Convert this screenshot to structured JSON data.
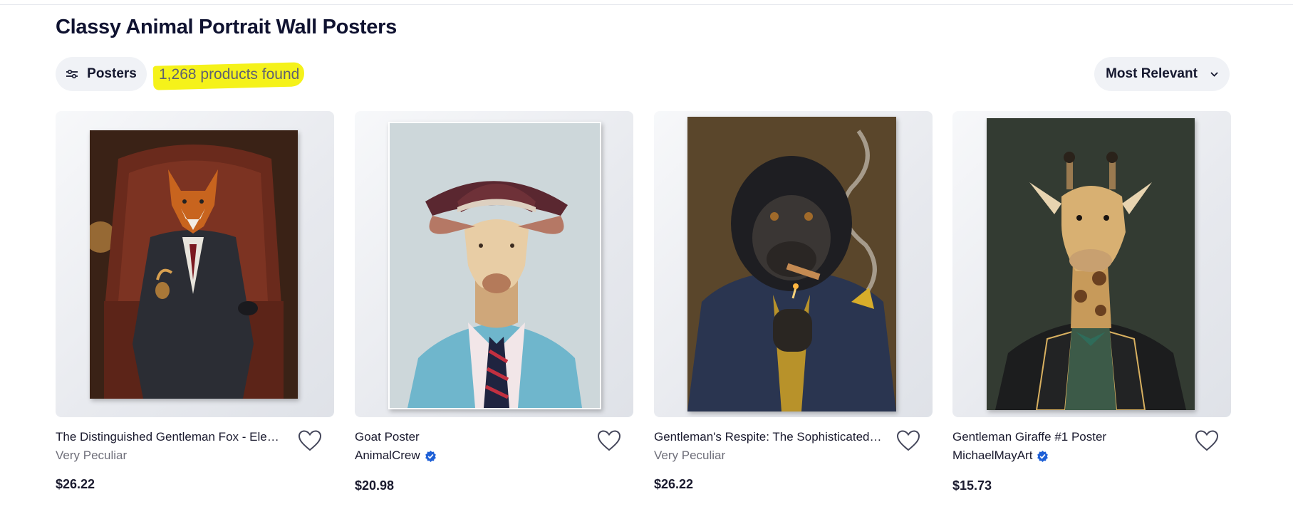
{
  "page": {
    "title": "Classy Animal Portrait Wall Posters",
    "filter_label": "Posters",
    "products_found": "1,268 products found",
    "sort_label": "Most Relevant",
    "highlight_color": "#f5f21a"
  },
  "icons": {
    "filter": "sliders-icon",
    "sort": "chevron-down-icon",
    "favorite": "heart-outline-icon",
    "verified": "verified-badge-icon"
  },
  "products": [
    {
      "title": "The Distinguished Gentleman Fox - Elegant...",
      "seller": "Very Peculiar",
      "verified": false,
      "price": "$26.22"
    },
    {
      "title": "Goat Poster",
      "seller": "AnimalCrew",
      "verified": true,
      "price": "$20.98"
    },
    {
      "title": "Gentleman's Respite: The Sophisticated S...",
      "seller": "Very Peculiar",
      "verified": false,
      "price": "$26.22"
    },
    {
      "title": "Gentleman Giraffe #1 Poster",
      "seller": "MichaelMayArt",
      "verified": true,
      "price": "$15.73"
    }
  ],
  "colors": {
    "verified_blue": "#1d5fd6",
    "chip_bg": "#f0f2f6",
    "text_dark": "#0f1230"
  }
}
